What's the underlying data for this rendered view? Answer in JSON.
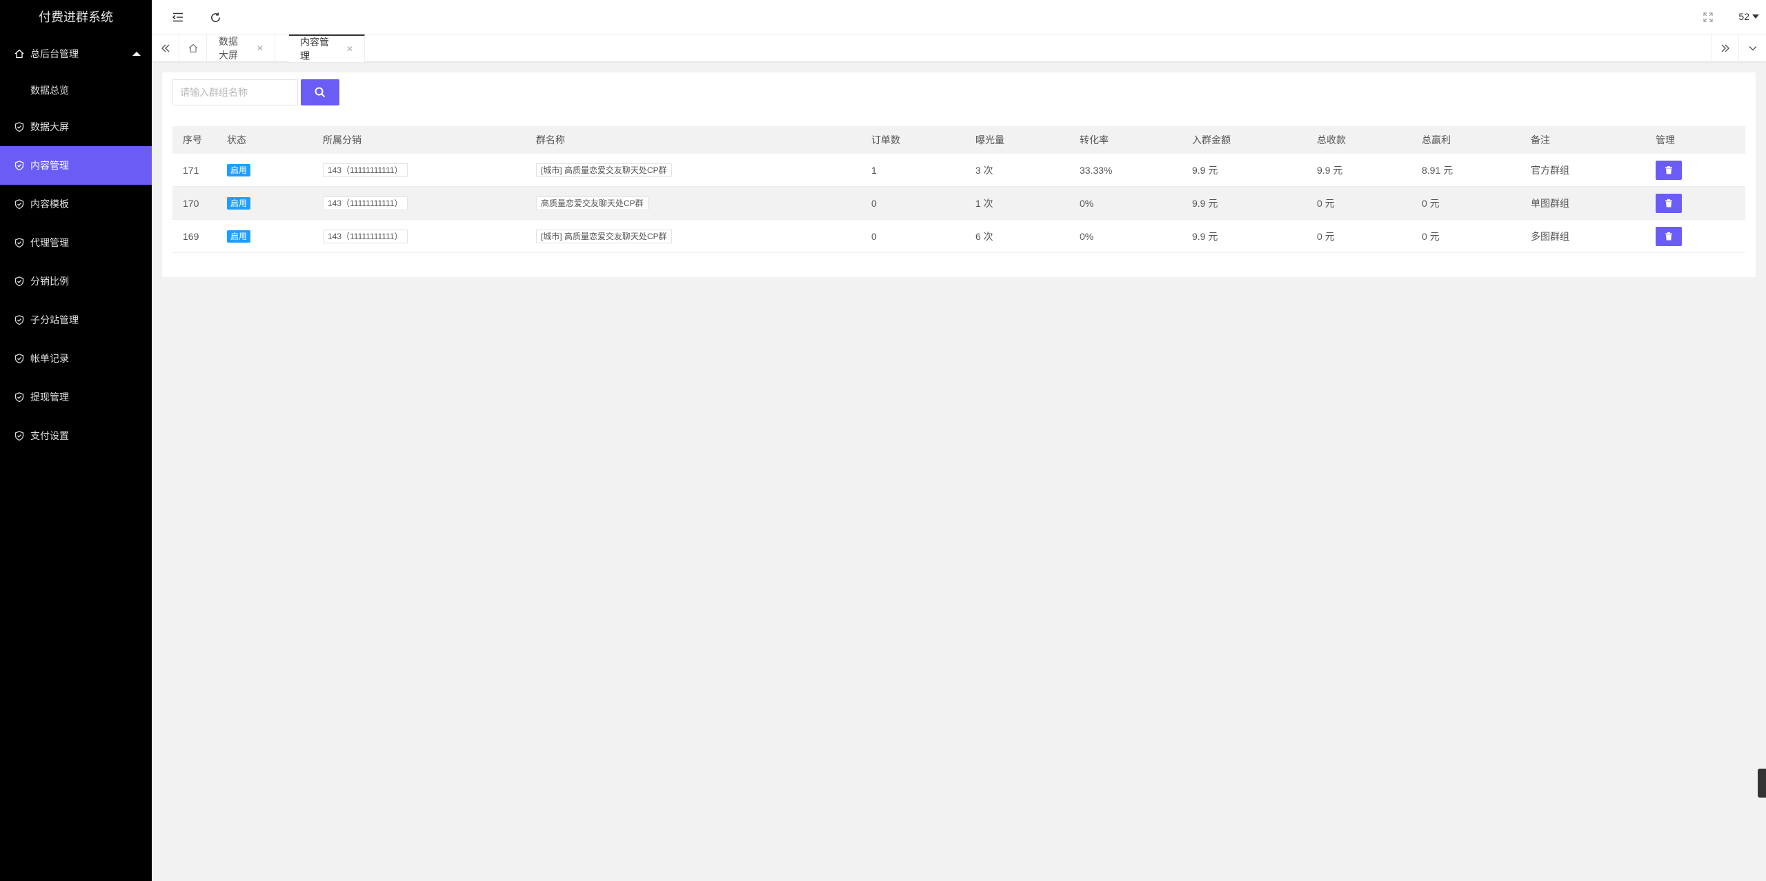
{
  "sidebar": {
    "logo": "付费进群系统",
    "parent_label": "总后台管理",
    "child_label": "数据总览",
    "items": [
      {
        "label": "数据大屏"
      },
      {
        "label": "内容管理"
      },
      {
        "label": "内容模板"
      },
      {
        "label": "代理管理"
      },
      {
        "label": "分销比例"
      },
      {
        "label": "子分站管理"
      },
      {
        "label": "帐单记录"
      },
      {
        "label": "提现管理"
      },
      {
        "label": "支付设置"
      }
    ]
  },
  "header": {
    "user_num": "52"
  },
  "tabs": [
    {
      "label": "数据大屏"
    },
    {
      "label": "内容管理"
    }
  ],
  "search": {
    "placeholder": "请输入群组名称"
  },
  "table": {
    "columns": [
      "序号",
      "状态",
      "所属分销",
      "群名称",
      "订单数",
      "曝光量",
      "转化率",
      "入群金额",
      "总收款",
      "总赢利",
      "备注",
      "管理"
    ],
    "rows": [
      {
        "id": "171",
        "status": "启用",
        "distributor": "143（11111111111）",
        "name": "[城市] 高质量恋爱交友聊天处CP群",
        "orders": "1",
        "views": "3 次",
        "rate": "33.33%",
        "price": "9.9 元",
        "total": "9.9 元",
        "profit": "8.91 元",
        "note": "官方群组"
      },
      {
        "id": "170",
        "status": "启用",
        "distributor": "143（11111111111）",
        "name": "高质量恋爱交友聊天处CP群",
        "orders": "0",
        "views": "1 次",
        "rate": "0%",
        "price": "9.9 元",
        "total": "0 元",
        "profit": "0 元",
        "note": "单图群组"
      },
      {
        "id": "169",
        "status": "启用",
        "distributor": "143（11111111111）",
        "name": "[城市] 高质量恋爱交友聊天处CP群",
        "orders": "0",
        "views": "6 次",
        "rate": "0%",
        "price": "9.9 元",
        "total": "0 元",
        "profit": "0 元",
        "note": "多图群组"
      }
    ]
  },
  "colors": {
    "accent": "#6b5cf6",
    "badge": "#1e9fff",
    "sidebar_bg": "#000000"
  }
}
